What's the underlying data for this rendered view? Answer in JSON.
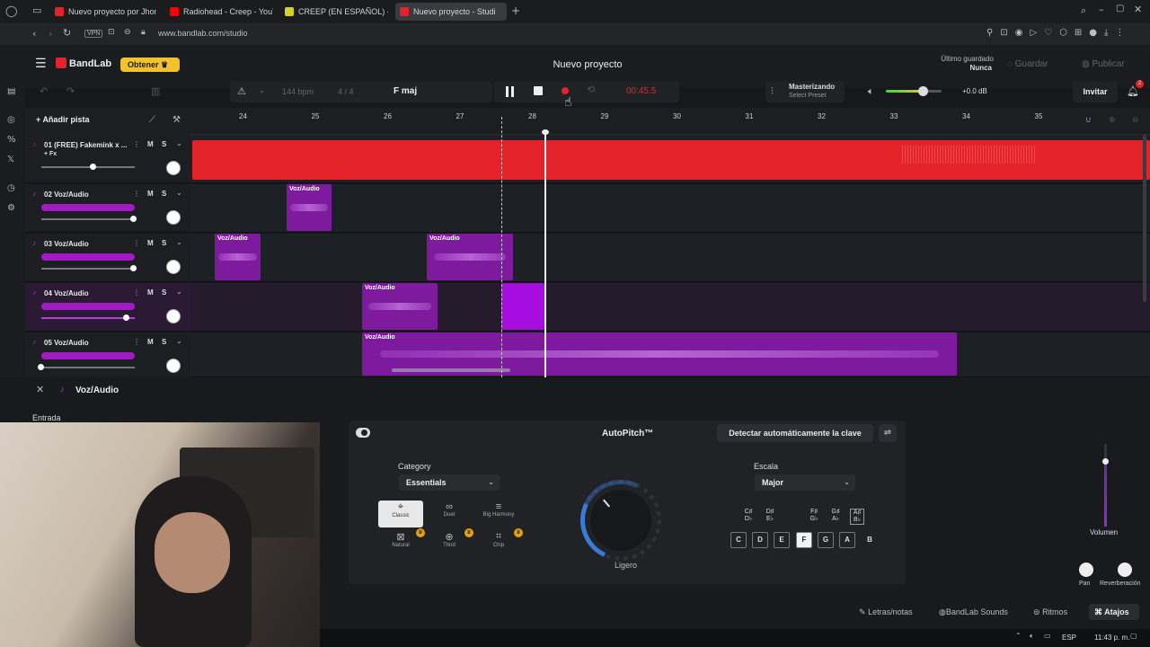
{
  "browser": {
    "tabs": [
      {
        "title": "Nuevo proyecto por Jhon",
        "color": "#e4222a"
      },
      {
        "title": "Radiohead - Creep - YouTu",
        "color": "#ff0000"
      },
      {
        "title": "CREEP (EN ESPAÑOL) - Ra",
        "color": "#d4d024"
      },
      {
        "title": "Nuevo proyecto - Studi",
        "color": "#e4222a"
      }
    ],
    "url": "www.bandlab.com/studio",
    "vpn": "VPN"
  },
  "app": {
    "logo": "BandLab",
    "get_button": "Obtener",
    "project_title": "Nuevo proyecto",
    "last_saved_label": "Último guardado",
    "last_saved_value": "Nunca",
    "save_button": "Guardar",
    "publish_button": "Publicar",
    "invite_button": "Invitar",
    "notification_count": "2",
    "accent": "#e4222a",
    "brand_gold": "#f2c12e"
  },
  "transport": {
    "bpm": "144 bpm",
    "time_sig": "4 / 4",
    "key": "F maj",
    "time": "00:45.5",
    "mastering_title": "Masterizando",
    "mastering_preset": "Select Preset",
    "master_volume": "+0.0 dB"
  },
  "tracks_panel": {
    "add_track": "Añadir pista"
  },
  "ruler": [
    "24",
    "25",
    "26",
    "27",
    "28",
    "29",
    "30",
    "31",
    "32",
    "33",
    "34",
    "35"
  ],
  "tracks": [
    {
      "name": "01  (FREE) Fakemink x ...",
      "fx": "+ Fx",
      "mute": "M",
      "solo": "S",
      "vol": 0.5
    },
    {
      "name": "02  Voz/Audio",
      "mute": "M",
      "solo": "S",
      "vol": 0.9
    },
    {
      "name": "03  Voz/Audio",
      "mute": "M",
      "solo": "S",
      "vol": 0.9
    },
    {
      "name": "04  Voz/Audio",
      "mute": "M",
      "solo": "S",
      "vol": 0.82
    },
    {
      "name": "05  Voz/Audio",
      "mute": "M",
      "solo": "S",
      "vol": 0.0
    }
  ],
  "clip_label": "Voz/Audio",
  "editor": {
    "track_name": "Voz/Audio",
    "input_label": "Entrada",
    "plugin_name": "AutoPitch™",
    "detect_key": "Detectar automáticamente la clave",
    "category_label": "Category",
    "category_value": "Essentials",
    "categories": [
      "Classic",
      "Duet",
      "Big Harmony",
      "Natural",
      "Third",
      "Chip"
    ],
    "knob_label": "Ligero",
    "scale_label": "Escala",
    "scale_value": "Major",
    "sharps": [
      "C♯\nD♭",
      "D♯\nE♭",
      "F♯\nG♭",
      "G♯\nA♭",
      "A♯\nB♭"
    ],
    "keys": [
      "C",
      "D",
      "E",
      "F",
      "G",
      "A",
      "B"
    ],
    "volume_label": "Volumen",
    "pan_label": "Pan",
    "reverb_label": "Reverberación"
  },
  "footer": {
    "lyrics": "Letras/notas",
    "sounds": "BandLab Sounds",
    "rhythms": "Ritmos",
    "shortcuts": "Atajos"
  },
  "taskbar": {
    "lang": "ESP",
    "time": "11:43 p. m."
  }
}
